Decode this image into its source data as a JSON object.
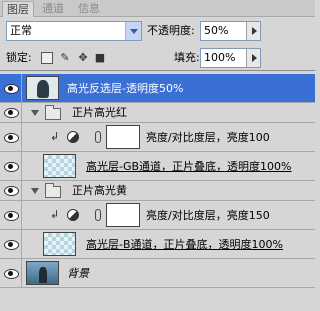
{
  "tabs": [
    {
      "label": "图层",
      "active": true
    },
    {
      "label": "通道",
      "active": false
    },
    {
      "label": "信息",
      "active": false
    }
  ],
  "blend_mode": {
    "value": "正常"
  },
  "opacity": {
    "label": "不透明度:",
    "value": "50%"
  },
  "lock": {
    "label": "锁定:"
  },
  "fill": {
    "label": "填充:",
    "value": "100%"
  },
  "layers": [
    {
      "name": "高光反选层-透明度50%",
      "kind": "pixel",
      "selected": true,
      "visible": true,
      "thumb": "figure"
    },
    {
      "name": "正片高光红",
      "kind": "group",
      "selected": false,
      "visible": true
    },
    {
      "name": "亮度/对比度层，亮度100",
      "kind": "adjustment",
      "selected": false,
      "visible": true
    },
    {
      "name": "高光层-GB通道，正片叠底，透明度100%",
      "kind": "pixel",
      "selected": false,
      "visible": true,
      "thumb": "checker"
    },
    {
      "name": "正片高光黄",
      "kind": "group",
      "selected": false,
      "visible": true
    },
    {
      "name": "亮度/对比度层，亮度150",
      "kind": "adjustment",
      "selected": false,
      "visible": true
    },
    {
      "name": "高光层-B通道，正片叠底，透明度100%",
      "kind": "pixel",
      "selected": false,
      "visible": true,
      "thumb": "checker"
    },
    {
      "name": "背景",
      "kind": "background",
      "selected": false,
      "visible": true,
      "thumb": "photo"
    }
  ],
  "colors": {
    "selection": "#3a6fd6",
    "panel": "#d6d6d6"
  }
}
